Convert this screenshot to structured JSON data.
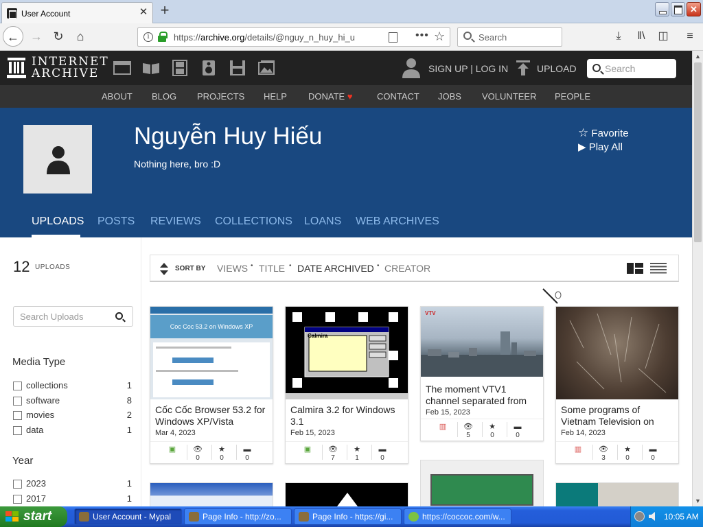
{
  "browser": {
    "tab_title": "User Account",
    "url_host_prefix": "https://",
    "url_host": "archive.org",
    "url_path": "/details/@nguy_n_huy_hi_u",
    "search_placeholder": "Search"
  },
  "ia": {
    "logo_line1": "INTERNET",
    "logo_line2": "ARCHIVE",
    "signup": "SIGN UP | LOG IN",
    "upload": "UPLOAD",
    "search_placeholder": "Search",
    "nav": [
      "ABOUT",
      "BLOG",
      "PROJECTS",
      "HELP",
      "DONATE",
      "CONTACT",
      "JOBS",
      "VOLUNTEER",
      "PEOPLE"
    ]
  },
  "profile": {
    "name": "Nguyễn Huy Hiếu",
    "bio": "Nothing here, bro :D",
    "favorite": "Favorite",
    "play_all": "Play All",
    "tabs": [
      "UPLOADS",
      "POSTS",
      "REVIEWS",
      "COLLECTIONS",
      "LOANS",
      "WEB ARCHIVES"
    ]
  },
  "sidebar": {
    "count": "12",
    "count_label": "UPLOADS",
    "search_placeholder": "Search Uploads",
    "media_type_title": "Media Type",
    "media_types": [
      {
        "label": "collections",
        "count": "1"
      },
      {
        "label": "software",
        "count": "8"
      },
      {
        "label": "movies",
        "count": "2"
      },
      {
        "label": "data",
        "count": "1"
      }
    ],
    "year_title": "Year",
    "years": [
      {
        "label": "2023",
        "count": "1"
      },
      {
        "label": "2017",
        "count": "1"
      }
    ]
  },
  "sort": {
    "label": "SORT BY",
    "views": "VIEWS",
    "title": "TITLE",
    "date": "DATE ARCHIVED",
    "creator": "CREATOR"
  },
  "cards": [
    {
      "title": "Cốc Cốc Browser 53.2 for Windows XP/Vista",
      "date": "Mar 4, 2023",
      "views": "0",
      "favs": "0",
      "reviews": "0",
      "thumb_title": "Coc Coc 53.2 on Windows XP"
    },
    {
      "title": "Calmira 3.2 for Windows 3.1",
      "date": "Feb 15, 2023",
      "views": "7",
      "favs": "1",
      "reviews": "0",
      "thumb_title": "Calmira"
    },
    {
      "title": "The moment VTV1 channel separated from",
      "date": "Feb 15, 2023",
      "views": "5",
      "favs": "0",
      "reviews": "0"
    },
    {
      "title": "Some programs of Vietnam Television on",
      "date": "Feb 14, 2023",
      "views": "3",
      "favs": "0",
      "reviews": "0"
    }
  ],
  "taskbar": {
    "start": "start",
    "tasks": [
      "User Account - Mypal",
      "Page Info - http://zo...",
      "Page Info - https://gi...",
      "https://coccoc.com/w..."
    ],
    "clock": "10:05 AM"
  },
  "colors": {
    "ia_dark": "#222222",
    "ia_nav": "#333333",
    "profile_blue": "#194880",
    "tab_inactive": "#8bb8e9",
    "software_green": "#5aa63c",
    "movie_red": "#d9534f"
  }
}
